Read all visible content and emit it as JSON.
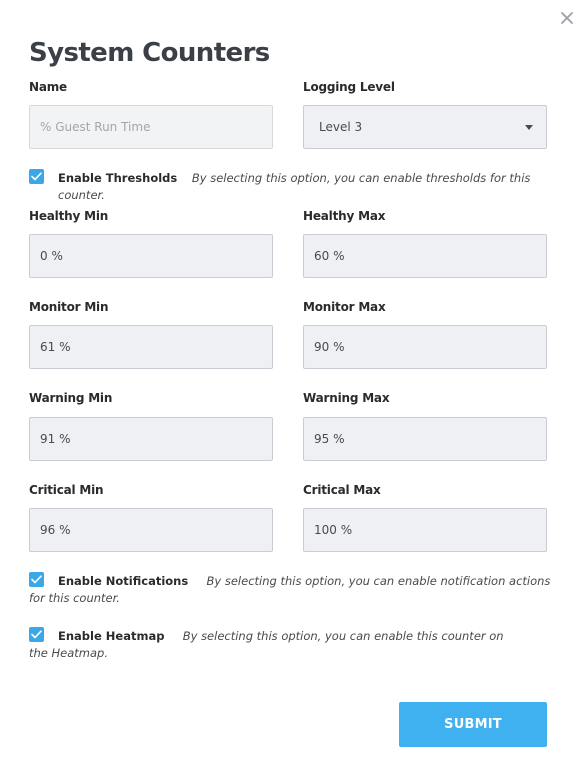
{
  "dialog": {
    "title": "System Counters",
    "close_icon": "close-icon"
  },
  "name_field": {
    "label": "Name",
    "placeholder": "% Guest Run Time",
    "value": ""
  },
  "logging_level": {
    "label": "Logging Level",
    "selected": "Level 3"
  },
  "thresholds_option": {
    "checked": true,
    "label": "Enable Thresholds",
    "description": "By selecting this option, you can enable thresholds for this counter."
  },
  "thresholds": {
    "healthy_min": {
      "label": "Healthy Min",
      "value": "0 %"
    },
    "healthy_max": {
      "label": "Healthy Max",
      "value": "60 %"
    },
    "monitor_min": {
      "label": "Monitor Min",
      "value": "61 %"
    },
    "monitor_max": {
      "label": "Monitor Max",
      "value": "90 %"
    },
    "warning_min": {
      "label": "Warning Min",
      "value": "91 %"
    },
    "warning_max": {
      "label": "Warning Max",
      "value": "95 %"
    },
    "critical_min": {
      "label": "Critical Min",
      "value": "96 %"
    },
    "critical_max": {
      "label": "Critical Max",
      "value": "100 %"
    }
  },
  "notifications_option": {
    "checked": true,
    "label": "Enable Notifications",
    "description": "By selecting this option, you can enable notification actions for this counter."
  },
  "heatmap_option": {
    "checked": true,
    "label": "Enable Heatmap",
    "description": "By selecting this option, you can enable this counter on the Heatmap."
  },
  "submit_label": "SUBMIT",
  "colors": {
    "accent": "#3fb0f0",
    "checkbox": "#3aa8e8",
    "input_bg": "#eef0f3"
  }
}
